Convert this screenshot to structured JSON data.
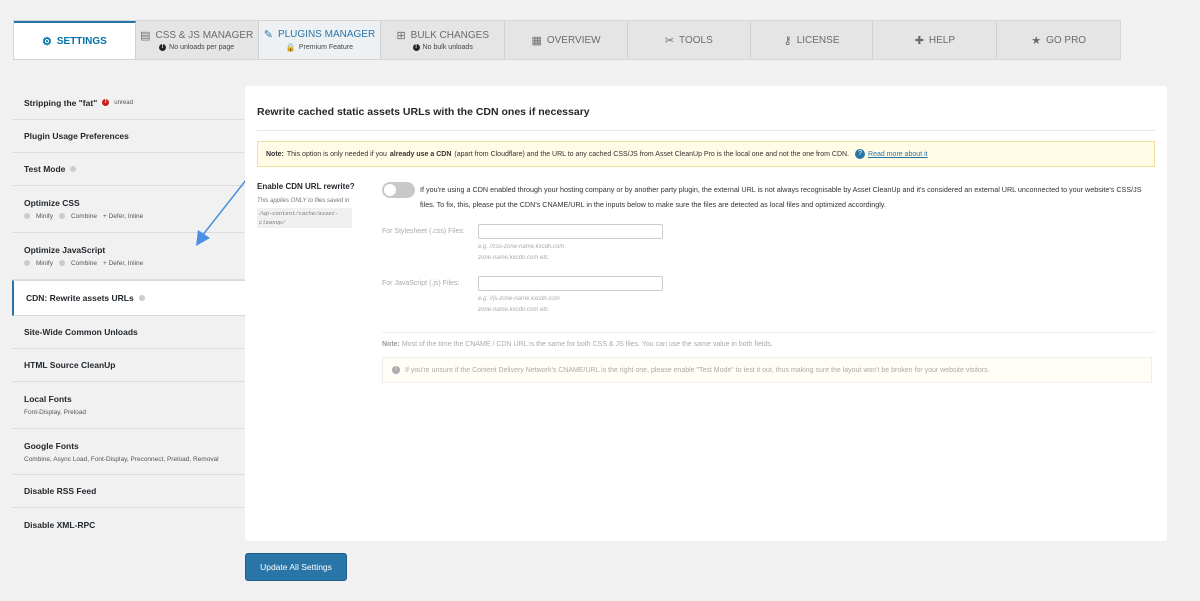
{
  "tabs": [
    {
      "label": "SETTINGS",
      "icon": "gear-icon",
      "glyph": "⚙",
      "sub": "",
      "active": true
    },
    {
      "label": "CSS & JS MANAGER",
      "icon": "file-icon",
      "glyph": "▤",
      "sub": "No unloads per page"
    },
    {
      "label": "PLUGINS MANAGER",
      "icon": "plug-icon",
      "glyph": "✎",
      "sub": "Premium Feature"
    },
    {
      "label": "BULK CHANGES",
      "icon": "sitemap-icon",
      "glyph": "⊞",
      "sub": "No bulk unloads"
    },
    {
      "label": "OVERVIEW",
      "icon": "document-icon",
      "glyph": "▦",
      "sub": ""
    },
    {
      "label": "TOOLS",
      "icon": "wrench-icon",
      "glyph": "✂",
      "sub": ""
    },
    {
      "label": "LICENSE",
      "icon": "key-icon",
      "glyph": "⚷",
      "sub": ""
    },
    {
      "label": "HELP",
      "icon": "lifebuoy-icon",
      "glyph": "✚",
      "sub": ""
    },
    {
      "label": "GO PRO",
      "icon": "star-icon",
      "glyph": "★",
      "sub": ""
    }
  ],
  "sidebar": {
    "items": [
      {
        "label": "Stripping the \"fat\"",
        "badge": "unread"
      },
      {
        "label": "Plugin Usage Preferences"
      },
      {
        "label": "Test Mode"
      },
      {
        "label": "Optimize CSS",
        "meta": [
          "Minify",
          "Combine",
          "+ Defer, Inline"
        ]
      },
      {
        "label": "Optimize JavaScript",
        "meta": [
          "Minify",
          "Combine",
          "+ Defer, Inline"
        ]
      },
      {
        "label": "CDN: Rewrite assets URLs"
      },
      {
        "label": "Site-Wide Common Unloads"
      },
      {
        "label": "HTML Source CleanUp"
      },
      {
        "label": "Local Fonts",
        "meta": [
          "Font-Display, Preload"
        ]
      },
      {
        "label": "Google Fonts",
        "meta": [
          "Combine, Async Load, Font-Display, Preconnect, Preload, Removal"
        ]
      },
      {
        "label": "Disable RSS Feed"
      },
      {
        "label": "Disable XML-RPC"
      }
    ]
  },
  "main": {
    "title": "Rewrite cached static assets URLs with the CDN ones if necessary",
    "note_label": "Note:",
    "note_pre": "This option is only needed if you",
    "note_bold": "already use a CDN",
    "note_post": "(apart from Cloudflare) and the URL to any cached CSS/JS from Asset CleanUp Pro is the local one and not the one from CDN.",
    "note_link": "Read more about it",
    "option_label": "Enable CDN URL rewrite?",
    "option_small": "This applies ONLY to files saved in",
    "option_path": "/wp-content/cache/asset-cleanup/",
    "option_desc": "If you're using a CDN enabled through your hosting company or by another party plugin, the external URL is not always recognisable by Asset CleanUp and it's considered an external URL unconnected to your website's CSS/JS files. To fix, this, please put the CDN's CNAME/URL in the inputs below to make sure the files are detected as local files and optimized accordingly.",
    "css_label": "For Stylesheet (.css) Files:",
    "css_hint1": "e.g. //css-zone-name.kxcdn.com",
    "css_hint2": "zone-name.kxcdn.com etc.",
    "js_label": "For JavaScript (.js) Files:",
    "js_hint1": "e.g. //js-zone-name.kxcdn.com",
    "js_hint2": "zone-name.kxcdn.com etc.",
    "bottom_note_label": "Note:",
    "bottom_note": "Most of the time the CNAME / CDN URL is the same for both CSS & JS files. You can use the same value in both fields.",
    "info_text": "If you're unsure if the Content Delivery Network's CNAME/URL is the right one, please enable \"Test Mode\" to test it out, thus making sure the layout won't be broken for your website visitors."
  },
  "footer": {
    "update_label": "Update All Settings"
  },
  "colors": {
    "accent": "#2a75a7",
    "alert": "#cc1818"
  }
}
